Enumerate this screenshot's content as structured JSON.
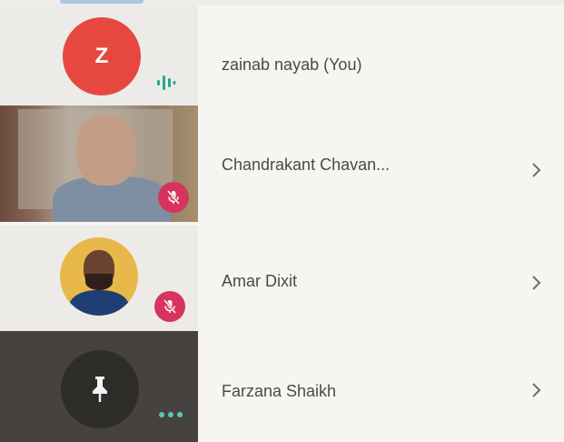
{
  "participants": [
    {
      "name": "zainab nayab (You)",
      "avatar_letter": "Z",
      "avatar_color": "#e6473f",
      "status": "speaking",
      "status_icon": "audio-bars-icon"
    },
    {
      "name": "Chandrakant Chavan...",
      "avatar": "camera-video",
      "status": "muted",
      "status_icon": "mic-off-icon"
    },
    {
      "name": "Amar Dixit",
      "avatar": "profile-photo",
      "status": "muted",
      "status_icon": "mic-off-icon"
    },
    {
      "name": "Farzana Shaikh",
      "avatar": "pin-placeholder",
      "status": "connecting",
      "status_icon": "more-dots-icon"
    }
  ],
  "colors": {
    "speaking_indicator": "#29a692",
    "muted_badge": "#d6345d",
    "accent_tab": "#a7c9e6"
  }
}
